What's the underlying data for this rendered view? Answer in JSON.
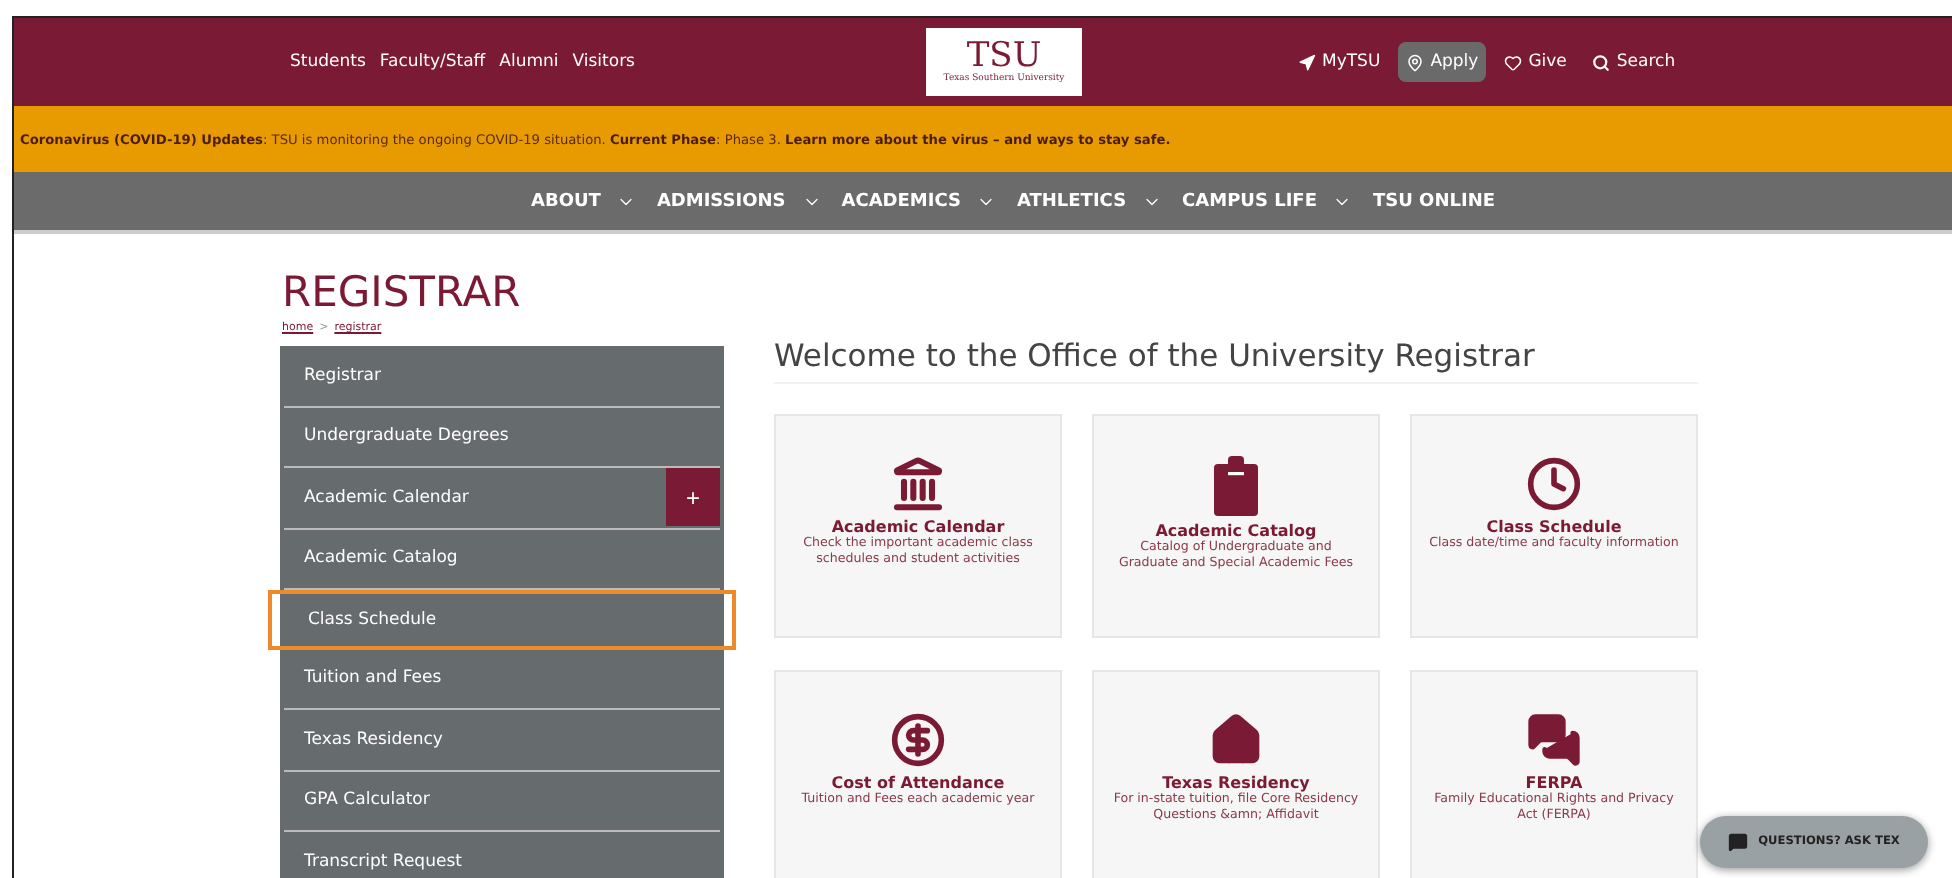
{
  "top_bar": {
    "audience_links": [
      "Students",
      "Faculty/Staff",
      "Alumni",
      "Visitors"
    ],
    "logo": {
      "wordmark": "TSU",
      "subtitle": "Texas Southern University"
    },
    "actions": [
      {
        "label": "MyTSU",
        "kind": "navigate",
        "selected": false
      },
      {
        "label": "Apply",
        "kind": "pin",
        "selected": true
      },
      {
        "label": "Give",
        "kind": "heart",
        "selected": false
      },
      {
        "label": "Search",
        "kind": "search",
        "selected": false
      }
    ]
  },
  "alert": "**Coronavirus (COVID-19) Updates**: TSU is monitoring the ongoing COVID-19 situation. **Current Phase**: Phase 3. **Learn more about the virus – and ways to stay safe.**",
  "main_nav": [
    {
      "label": "ABOUT",
      "has_menu": true
    },
    {
      "label": "ADMISSIONS",
      "has_menu": true
    },
    {
      "label": "ACADEMICS",
      "has_menu": true
    },
    {
      "label": "ATHLETICS",
      "has_menu": true
    },
    {
      "label": "CAMPUS LIFE",
      "has_menu": true
    },
    {
      "label": "TSU ONLINE",
      "has_menu": false
    }
  ],
  "page_title": "REGISTRAR",
  "breadcrumb": [
    "home",
    "registrar"
  ],
  "breadcrumb_separator": ">",
  "sidebar": {
    "items": [
      {
        "label": "Registrar",
        "highlighted": false
      },
      {
        "label": "Undergraduate Degrees",
        "highlighted": false
      },
      {
        "label": "Academic Calendar",
        "highlighted": false,
        "expand_toggle": "+"
      },
      {
        "label": "Academic Catalog",
        "highlighted": false
      },
      {
        "label": "Class Schedule",
        "highlighted": true
      },
      {
        "label": "Tuition and Fees",
        "highlighted": false
      },
      {
        "label": "Texas Residency",
        "highlighted": false
      },
      {
        "label": "GPA Calculator",
        "highlighted": false
      },
      {
        "label": "Transcript Request",
        "highlighted": false
      }
    ]
  },
  "heading": "Welcome to the Office of the University Registrar",
  "cards": [
    {
      "kind": "bank",
      "title": "Academic Calendar",
      "description": "Check the important academic class schedules and student activities"
    },
    {
      "kind": "clipboard",
      "title": "Academic Catalog",
      "description": "Catalog of Undergraduate and Graduate and Special Academic Fees"
    },
    {
      "kind": "clock",
      "title": "Class Schedule",
      "description": "Class date/time and faculty information"
    },
    {
      "kind": "dollar",
      "title": "Cost of Attendance",
      "description": "Tuition and Fees each academic year"
    },
    {
      "kind": "house",
      "title": "Texas Residency",
      "description": "For in-state tuition, file Core Residency Questions &amn; Affidavit"
    },
    {
      "kind": "chat",
      "title": "FERPA",
      "description": "Family Educational Rights and Privacy Act (FERPA)"
    }
  ],
  "chat_button": {
    "label": "QUESTIONS? ASK TEX"
  }
}
